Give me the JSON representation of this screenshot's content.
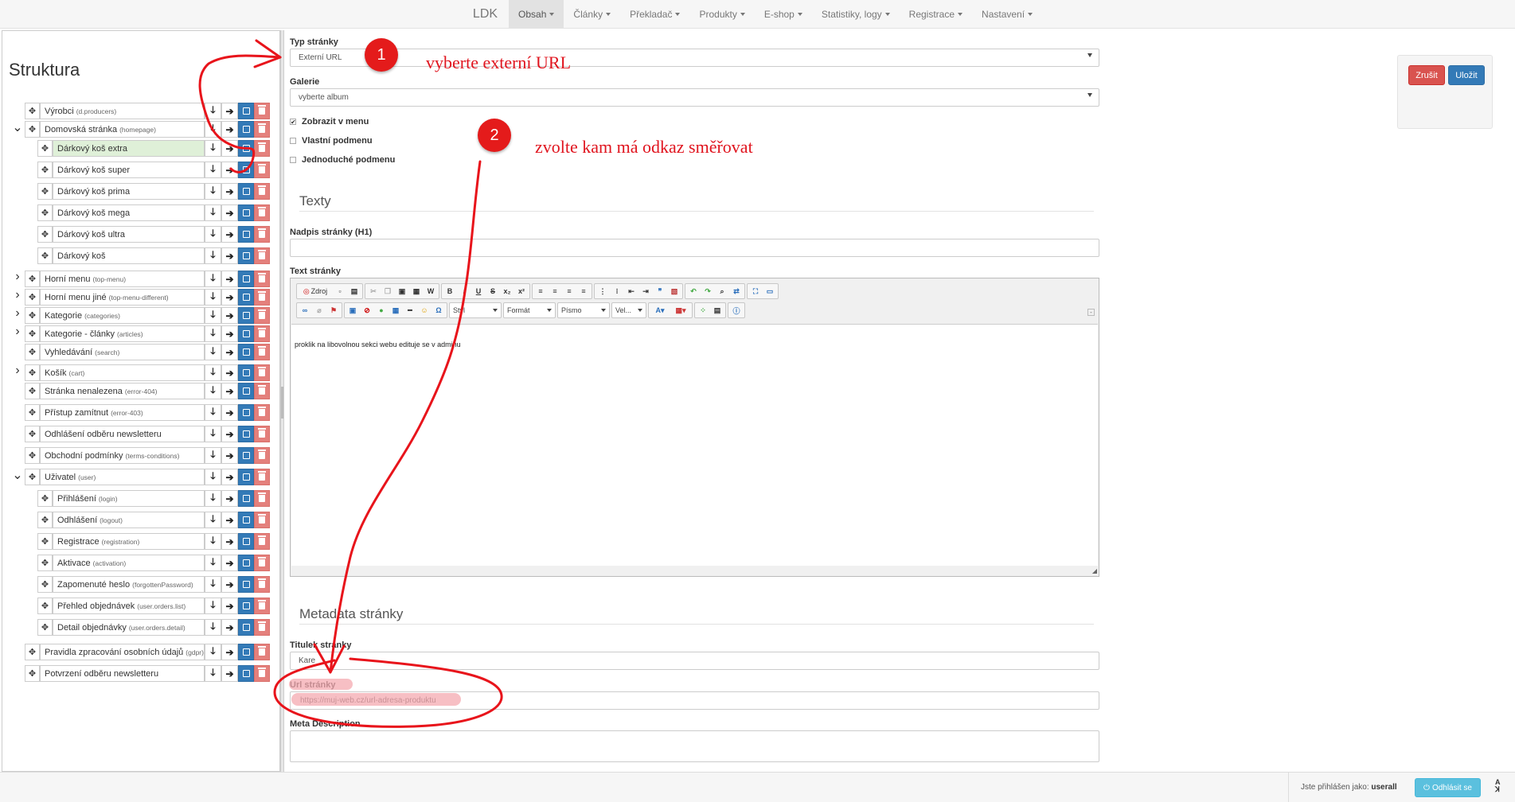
{
  "topnav": {
    "brand": "LDK",
    "items": [
      {
        "label": "Obsah",
        "active": true
      },
      {
        "label": "Články"
      },
      {
        "label": "Překladač"
      },
      {
        "label": "Produkty"
      },
      {
        "label": "E-shop"
      },
      {
        "label": "Statistiky, logy"
      },
      {
        "label": "Registrace"
      },
      {
        "label": "Nastavení"
      }
    ]
  },
  "sidebar": {
    "title": "Struktura",
    "items": [
      {
        "label": "Výrobci",
        "key": "(d.producers)",
        "level": 0,
        "expander": ""
      },
      {
        "label": "Domovská stránka",
        "key": "(homepage)",
        "level": 0,
        "expander": "expanded"
      },
      {
        "label": "Dárkový koš extra",
        "key": "",
        "level": 1,
        "expander": "",
        "selected": true
      },
      {
        "label": "Dárkový koš super",
        "key": "",
        "level": 1,
        "expander": ""
      },
      {
        "label": "Dárkový koš prima",
        "key": "",
        "level": 1,
        "expander": ""
      },
      {
        "label": "Dárkový koš mega",
        "key": "",
        "level": 1,
        "expander": ""
      },
      {
        "label": "Dárkový koš ultra",
        "key": "",
        "level": 1,
        "expander": ""
      },
      {
        "label": "Dárkový koš",
        "key": "",
        "level": 1,
        "expander": ""
      },
      {
        "label": "Horní menu",
        "key": "(top-menu)",
        "level": 0,
        "expander": "collapsed"
      },
      {
        "label": "Horní menu jiné",
        "key": "(top-menu-different)",
        "level": 0,
        "expander": "collapsed"
      },
      {
        "label": "Kategorie",
        "key": "(categories)",
        "level": 0,
        "expander": "collapsed"
      },
      {
        "label": "Kategorie - články",
        "key": "(articles)",
        "level": 0,
        "expander": "collapsed"
      },
      {
        "label": "Vyhledávání",
        "key": "(search)",
        "level": 0,
        "expander": ""
      },
      {
        "label": "Košík",
        "key": "(cart)",
        "level": 0,
        "expander": "collapsed"
      },
      {
        "label": "Stránka nenalezena",
        "key": "(error-404)",
        "level": 0,
        "expander": ""
      },
      {
        "label": "Přístup zamítnut",
        "key": "(error-403)",
        "level": 0,
        "expander": ""
      },
      {
        "label": "Odhlášení odběru newsletteru",
        "key": "",
        "level": 0,
        "expander": ""
      },
      {
        "label": "Obchodní podmínky",
        "key": "(terms-conditions)",
        "level": 0,
        "expander": ""
      },
      {
        "label": "Uživatel",
        "key": "(user)",
        "level": 0,
        "expander": "expanded"
      },
      {
        "label": "Přihlášení",
        "key": "(login)",
        "level": 1,
        "expander": ""
      },
      {
        "label": "Odhlášení",
        "key": "(logout)",
        "level": 1,
        "expander": ""
      },
      {
        "label": "Registrace",
        "key": "(registration)",
        "level": 1,
        "expander": ""
      },
      {
        "label": "Aktivace",
        "key": "(activation)",
        "level": 1,
        "expander": ""
      },
      {
        "label": "Zapomenuté heslo",
        "key": "(forgottenPassword)",
        "level": 1,
        "expander": ""
      },
      {
        "label": "Přehled objednávek",
        "key": "(user.orders.list)",
        "level": 1,
        "expander": ""
      },
      {
        "label": "Detail objednávky",
        "key": "(user.orders.detail)",
        "level": 1,
        "expander": ""
      },
      {
        "label": "Pravidla zpracování osobních údajů",
        "key": "(gdpr)",
        "level": 0,
        "expander": ""
      },
      {
        "label": "Potvrzení odběru newsletteru",
        "key": "",
        "level": 0,
        "expander": ""
      }
    ]
  },
  "form": {
    "page_type": {
      "label": "Typ stránky",
      "value": "Externí URL"
    },
    "gallery": {
      "label": "Galerie",
      "value": "vyberte album"
    },
    "checkboxes": [
      {
        "label": "Zobrazit v menu",
        "checked": true
      },
      {
        "label": "Vlastní podmenu",
        "checked": false
      },
      {
        "label": "Jednoduché podmenu",
        "checked": false
      }
    ],
    "texts_section": "Texty",
    "heading": {
      "label": "Nadpis stránky (H1)",
      "value": ""
    },
    "page_text": {
      "label": "Text stránky",
      "content": "proklik na libovolnou sekci webu edituje se v adminu"
    },
    "toolbar": {
      "source": "Zdroj",
      "style": "Styl",
      "format": "Formát",
      "font": "Písmo",
      "size": "Vel..."
    },
    "metadata_section": "Metadata stránky",
    "page_title": {
      "label": "Titulek stránky",
      "value": "Kare"
    },
    "url": {
      "label": "Url stránky",
      "value": "https://muj-web.cz/url-adresa-produktu"
    },
    "meta_description": {
      "label": "Meta Description",
      "value": ""
    }
  },
  "actions": {
    "cancel": "Zrušit",
    "save": "Uložit"
  },
  "footer": {
    "logged_in_as": "Jste přihlášen jako:",
    "user": "userall",
    "logout": "Odhlásit se"
  },
  "annotations": {
    "badge1": "1",
    "text1": "vyberte externí URL",
    "badge2": "2",
    "text2": "zvolte kam má odkaz směřovat",
    "color": "#e0141e"
  }
}
